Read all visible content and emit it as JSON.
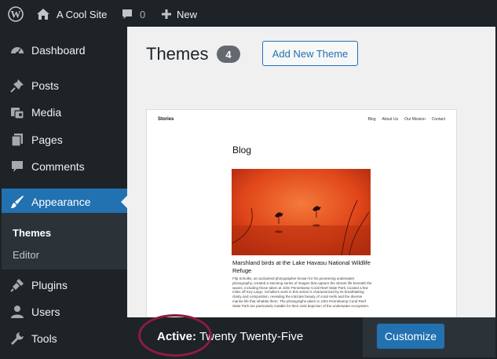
{
  "admin_bar": {
    "site_name": "A Cool Site",
    "comments_count": "0",
    "new_label": "New",
    "icons": [
      "wordpress-logo-icon",
      "home-icon",
      "comment-bubble-icon",
      "plus-icon"
    ]
  },
  "sidebar": {
    "items": [
      {
        "label": "Dashboard",
        "icon": "dashboard-icon"
      },
      {
        "label": "Posts",
        "icon": "pin-icon"
      },
      {
        "label": "Media",
        "icon": "media-icon"
      },
      {
        "label": "Pages",
        "icon": "pages-icon"
      },
      {
        "label": "Comments",
        "icon": "comment-icon"
      },
      {
        "label": "Appearance",
        "icon": "brush-icon",
        "current": true
      },
      {
        "label": "Plugins",
        "icon": "plug-icon"
      },
      {
        "label": "Users",
        "icon": "user-icon"
      },
      {
        "label": "Tools",
        "icon": "wrench-icon"
      }
    ],
    "submenu": [
      {
        "label": "Themes",
        "active": true
      },
      {
        "label": "Editor"
      }
    ]
  },
  "main": {
    "title": "Themes",
    "count": "4",
    "add_new_label": "Add New Theme",
    "active_theme": {
      "active_label": "Active:",
      "name": "Twenty Twenty-Five",
      "customize_label": "Customize",
      "screenshot": {
        "brand": "Stories",
        "nav": [
          "Blog",
          "About Us",
          "Our Mission",
          "Contact"
        ],
        "heading": "Blog",
        "post_title": "Marshland birds at the Lake Havasu National Wildlife Refuge",
        "post_excerpt": "Flip Schulke, an acclaimed photographer known for his pioneering underwater photography, created a stunning series of images that capture the vibrant life beneath the waves, including those taken at John Pennekamp Coral Reef State Park, located a few miles off Key Largo. Schulke's work in this series is characterized by its breathtaking clarity and composition, revealing the intricate beauty of coral reefs and the diverse marine life that inhabits them. The photographs taken in John Pennekamp Coral Reef State Park are particularly notable for their vivid depiction of the underwater ecosystem."
      }
    }
  },
  "colors": {
    "admin_dark": "#1d2327",
    "accent_blue": "#2271b1",
    "content_bg": "#f0f0f1",
    "highlight_ring": "#8c1c3f"
  }
}
